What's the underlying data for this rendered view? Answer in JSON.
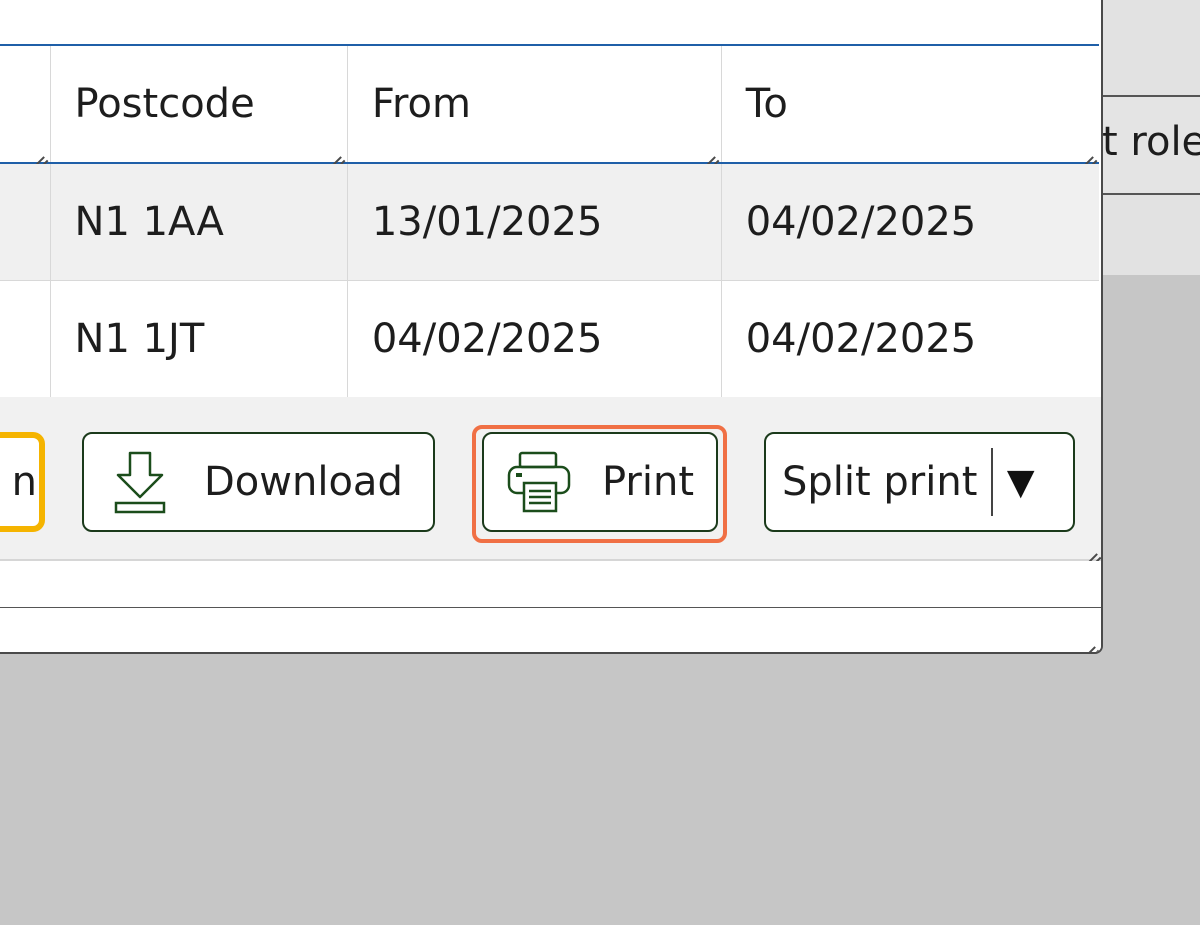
{
  "background": {
    "column_header_partial": "t role"
  },
  "table": {
    "columns": [
      "Postcode",
      "From",
      "To"
    ],
    "rows": [
      {
        "postcode": "N1 1AA",
        "from": "13/01/2025",
        "to": "04/02/2025"
      },
      {
        "postcode": "N1 1JT",
        "from": "04/02/2025",
        "to": "04/02/2025"
      }
    ]
  },
  "toolbar": {
    "partial_button_label": "n",
    "download_label": "Download",
    "print_label": "Print",
    "split_print_label": "Split print",
    "split_caret": "▼"
  },
  "colors": {
    "focus_ring": "#f07045",
    "active_button_border": "#f5b400",
    "header_rule": "#1f5fa8",
    "icon_green": "#1b4d1b"
  }
}
